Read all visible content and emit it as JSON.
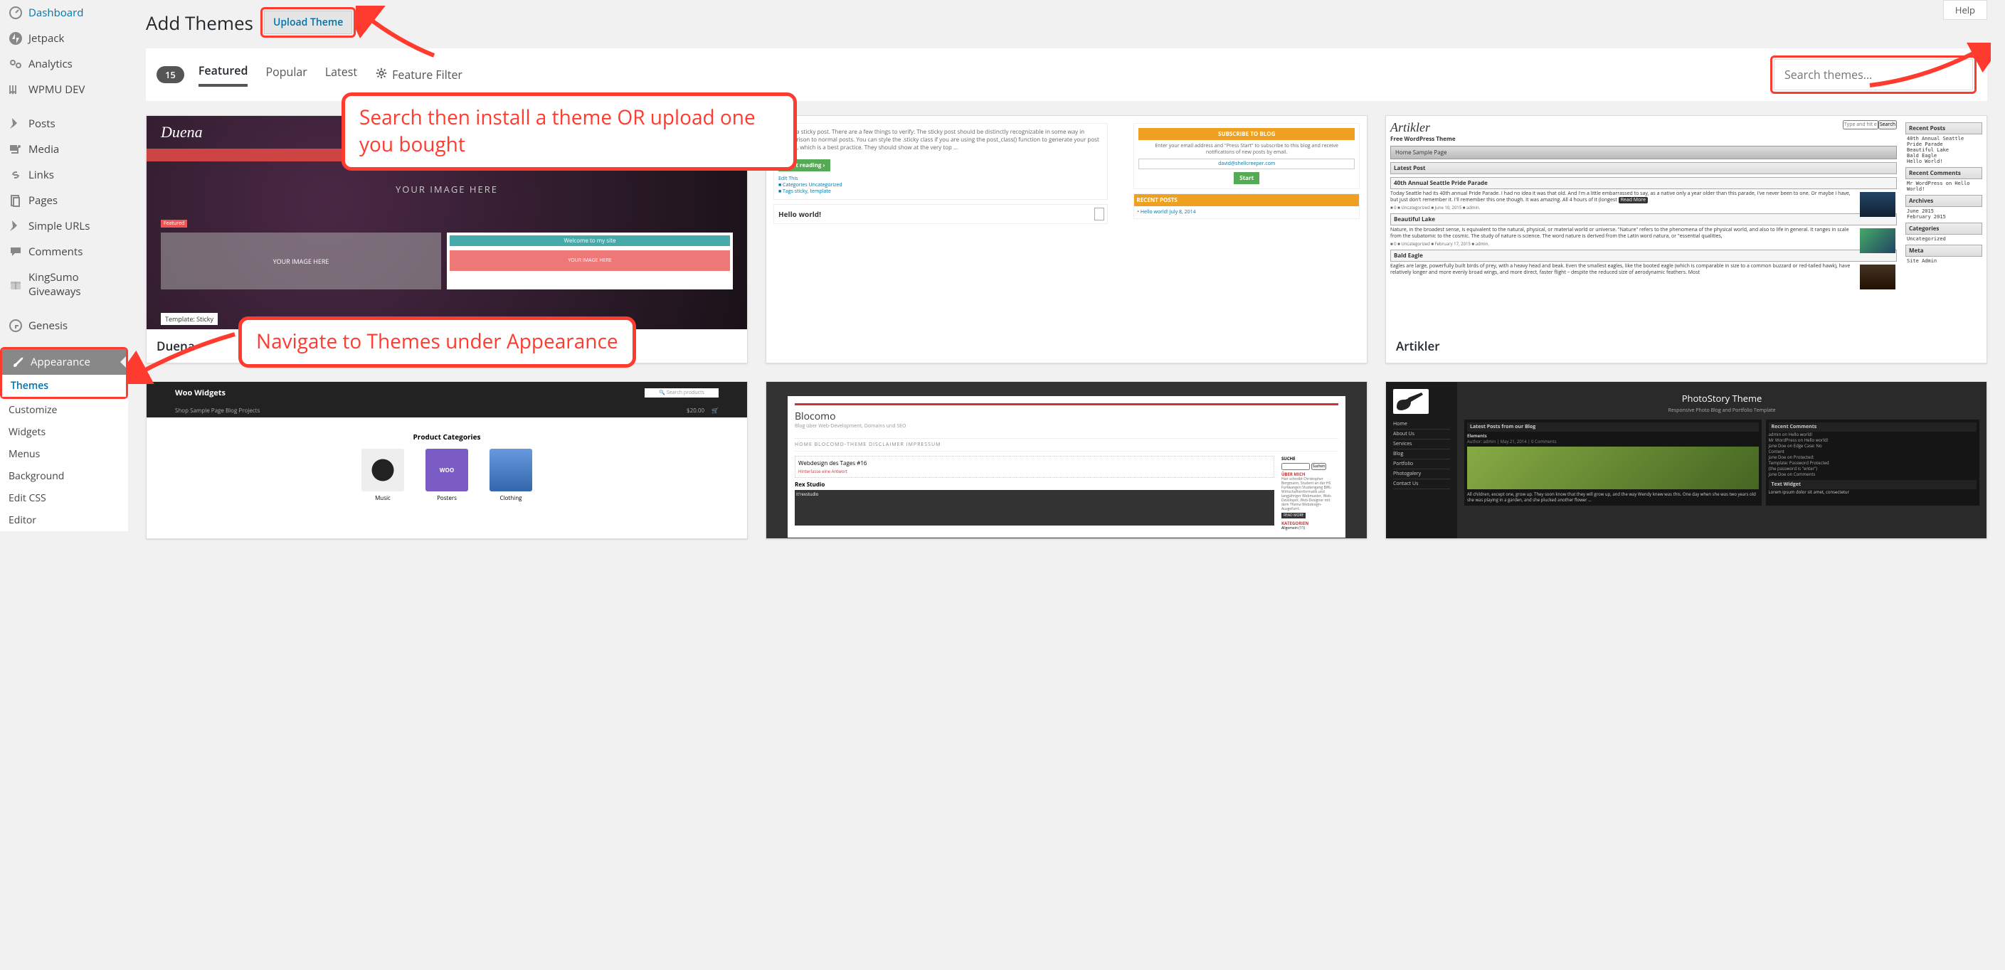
{
  "sidebar": {
    "items": [
      {
        "label": "Dashboard"
      },
      {
        "label": "Jetpack"
      },
      {
        "label": "Analytics"
      },
      {
        "label": "WPMU DEV"
      },
      {
        "label": "Posts"
      },
      {
        "label": "Media"
      },
      {
        "label": "Links"
      },
      {
        "label": "Pages"
      },
      {
        "label": "Simple URLs"
      },
      {
        "label": "Comments"
      },
      {
        "label": "KingSumo Giveaways"
      },
      {
        "label": "Genesis"
      },
      {
        "label": "Appearance"
      }
    ],
    "appearance_sub": [
      {
        "label": "Themes"
      },
      {
        "label": "Customize"
      },
      {
        "label": "Widgets"
      },
      {
        "label": "Menus"
      },
      {
        "label": "Background"
      },
      {
        "label": "Edit CSS"
      },
      {
        "label": "Editor"
      }
    ]
  },
  "header": {
    "title": "Add Themes",
    "upload_label": "Upload Theme",
    "help_label": "Help"
  },
  "filters": {
    "count": "15",
    "featured": "Featured",
    "popular": "Popular",
    "latest": "Latest",
    "feature_filter": "Feature Filter"
  },
  "search": {
    "placeholder": "Search themes..."
  },
  "themes": [
    {
      "name": "Duena"
    },
    {
      "name": ""
    },
    {
      "name": "Artikler"
    },
    {
      "name": ""
    },
    {
      "name": ""
    },
    {
      "name": ""
    }
  ],
  "annotations": {
    "callout_top": "Search then install a theme OR upload one you bought",
    "callout_mid": "Navigate to Themes under Appearance"
  },
  "mock": {
    "duena": {
      "logo": "Duena",
      "hero": "YOUR  IMAGE  HERE",
      "col1": "YOUR  IMAGE  HERE",
      "welcome": "Welcome to my site",
      "template": "Template: Sticky",
      "featured": "Featured"
    },
    "shell": {
      "sticky_body": "This is a sticky post. There are a few things to verify: The sticky post should be distinctly recognizable in some way in comparison to normal posts. You can style the .sticky class if you are using the post_class() function to generate your post classes, which is a best practice. They should show at the very top …",
      "start_reading": "Start reading  ›",
      "edit": "Edit This",
      "cats": "Categories Uncategorized",
      "tags": "Tags sticky, template",
      "hello": "Hello world!",
      "sub_head": "SUBSCRIBE TO BLOG",
      "sub_body": "Enter your email address and \"Press Start\" to subscribe to this blog and receive notifications of new posts by email.",
      "email": "david@shellcreeper.com",
      "start": "Start",
      "recent_head": "RECENT POSTS",
      "recent_item": "Hello world! July 8, 2014"
    },
    "artikler": {
      "logo": "Artikler",
      "tagline": "Free WordPress Theme",
      "nav": "Home   Sample Page",
      "search_ph": "Type and hit enter",
      "search_btn": "Search",
      "latest_head": "Latest Post",
      "post1_title": "40th Annual Seattle Pride Parade",
      "post1_body": "Today Seattle had its 40th annual Pride Parade. I had no idea it was that old. And I'm a little embarrassed to say, as a native only a year older than this parade, I've never been to one. Or maybe I have, but just don't remember it. I'll remember this one though. It was amazing. All 4 hours of it (longest",
      "read_more": "Read More",
      "post1_meta": "■ 0  ■ Uncategorized  ■ June 10, 2015  ■ admin.",
      "post2_title": "Beautiful Lake",
      "post2_body": "Nature, in the broadest sense, is equivalent to the natural, physical, or material world or universe. \"Nature\" refers to the phenomena of the physical world, and also to life in general. It ranges in scale from the subatomic to the cosmic. The study of nature is science. The word nature is derived from the Latin word natura, or \"essential qualities,",
      "post2_meta": "■ 0  ■ Uncategorized  ■ February 17, 2015  ■ admin.",
      "post3_title": "Bald Eagle",
      "post3_body": "Eagles are large, powerfully built birds of prey, with a heavy head and beak. Even the smallest eagles, like the booted eagle (which is comparable in size to a common buzzard or red-tailed hawk), have relatively longer and more evenly broad wings, and more direct, faster flight – despite the reduced size of aerodynamic feathers. Most",
      "w_recent_posts": "Recent Posts",
      "w_rp_items": "40th Annual Seattle Pride Parade\nBeautiful Lake\nBald Eagle\nHello World!",
      "w_recent_comments": "Recent Comments",
      "w_rc_items": "Mr WordPress on Hello World!",
      "w_archives": "Archives",
      "w_ar_items": "June 2015\nFebruary 2015",
      "w_categories": "Categories",
      "w_cat_items": "Uncategorized",
      "w_meta": "Meta",
      "w_meta_items": "Site Admin"
    },
    "woo": {
      "title": "Woo Widgets",
      "nav": "Shop    Sample Page    Blog    Projects",
      "price": "$20.00",
      "cat_head": "Product Categories",
      "p1": "Music",
      "p2": "Posters",
      "p3": "Clothing"
    },
    "blocomo": {
      "title": "Blocomo",
      "sub": "Blog über Web-Development, Domains und SEO",
      "nav": "HOME       BLOCOMO-THEME       DISCLAIMER       IMPRESSUM",
      "post1": "Webdesign des Tages #16",
      "rex": "Rex Studio",
      "side_about": "ÜBER MICH",
      "side_about_body": "Hier schreibt Christopher Bergmann, Student an der HS Furtwangen Studiengang BWL-Wirtschaftsinformatik und langjähriger Webmaster, Web-Developer, Web-Designer mit dem Thema Webdesign-Ausgefurrt.",
      "side_more": "READ MORE",
      "side_cat": "KATEGORIEN",
      "side_cat_body": "Allgemein (11)",
      "search": "SUCHE",
      "search_btn": "Suchen"
    },
    "photo": {
      "title": "PhotoStory Theme",
      "sub": "Responsive Photo Blog and Portfolio Template",
      "menu": [
        "Home",
        "About Us",
        "Services",
        "Blog",
        "Portfolio",
        "Photogalery",
        "Contact Us"
      ],
      "w1_head": "Latest Posts from our Blog",
      "w1_sub": "Elements",
      "w1_meta": "Author: admin | May 21, 2014 | 0 Comments",
      "w1_body": "All children, except one, grow up. They soon know that they will grow up, and the way Wendy knew was this. One day when she was two years old she was playing in a garden, and she plucked another flower ...",
      "w2_head": "Recent Comments",
      "w2_items": "admin on Hello world!\nMr WordPress on Hello world!\nJane Doe on Edge Case: No\nContent\nJane Doe on Protected:\nTemplate: Password Protected\n(the password is \"enter\")\nJane Doe on Comments",
      "w3_head": "Text Widget",
      "w3_body": "Lorem ipsum dolor sit amet, consectetur"
    }
  }
}
